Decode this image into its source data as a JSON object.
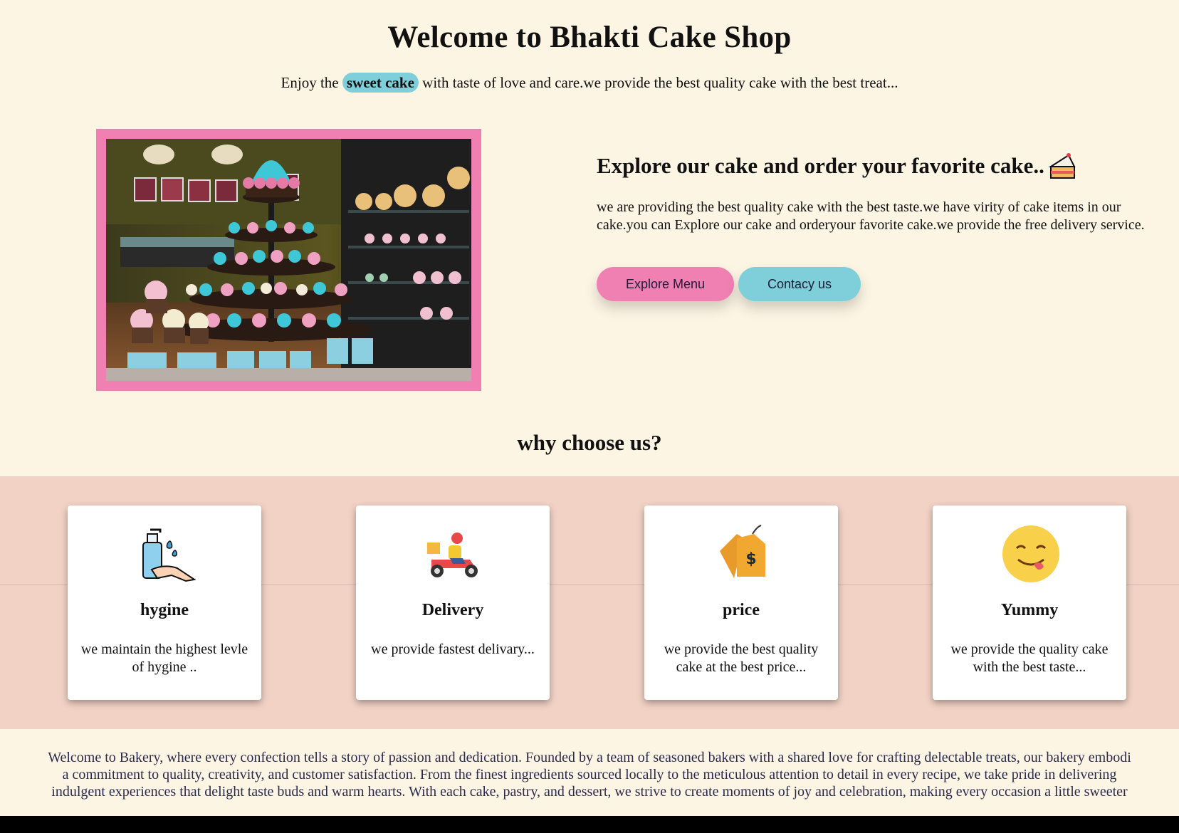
{
  "header": {
    "title": "Welcome to Bhakti Cake Shop",
    "tagline_before": "Enjoy the",
    "tagline_highlight": "sweet cake",
    "tagline_after": "with taste of love and care.we provide the best quality cake with the best treat..."
  },
  "hero": {
    "image_icon": "cupcake-display-photo",
    "heading": "Explore our cake and order your favorite cake..",
    "heading_icon": "cake-slice-icon",
    "text": "we are providing the best quality cake with the best taste.we have virity of cake items in our cake.you can Explore our cake and orderyour favorite cake.we provide the free delivery service.",
    "explore_button": "Explore Menu",
    "contact_button": "Contacy us"
  },
  "why": {
    "title": "why choose us?",
    "cards": [
      {
        "icon": "hand-wash-icon",
        "title": "hygine",
        "text": "we maintain the highest levle of hygine .."
      },
      {
        "icon": "delivery-scooter-icon",
        "title": "Delivery",
        "text": "we provide fastest delivary..."
      },
      {
        "icon": "price-tag-icon",
        "title": "price",
        "text": "we provide the best quality cake at the best price..."
      },
      {
        "icon": "yummy-face-icon",
        "title": "Yummy",
        "text": "we provide the quality cake with the best taste..."
      }
    ]
  },
  "about": {
    "line1": "Welcome to Bakery, where every confection tells a story of passion and dedication. Founded by a team of seasoned bakers with a shared love for crafting delectable treats, our bakery embodi",
    "line2": "a commitment to quality, creativity, and customer satisfaction. From the finest ingredients sourced locally to the meticulous attention to detail in every recipe, we take pride in delivering",
    "line3": "indulgent experiences that delight taste buds and warm hearts. With each cake, pastry, and dessert, we strive to create moments of joy and celebration, making every occasion a little sweeter"
  },
  "colors": {
    "background": "#fdf5e4",
    "pink": "#f07fb2",
    "teal": "#7ecfd9",
    "band": "#f2d2c5",
    "footer": "#000000"
  }
}
